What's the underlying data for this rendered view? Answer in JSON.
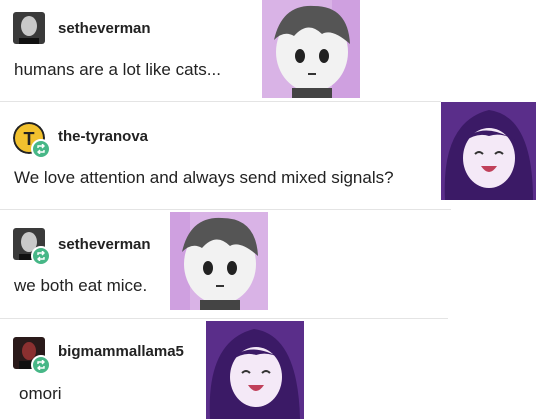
{
  "posts": [
    {
      "username": "setheverman",
      "text": "humans are a lot like cats...",
      "avatar_icon": "bald-man-avatar",
      "reblog": false,
      "image": "omori-boy-drawing"
    },
    {
      "username": "the-tyranova",
      "text": "We love attention and always send mixed signals?",
      "avatar_icon": "tyranova-logo-avatar",
      "reblog": true,
      "image": "omori-girl-laughing-drawing"
    },
    {
      "username": "setheverman",
      "text": "we both eat mice.",
      "avatar_icon": "bald-man-avatar",
      "reblog": true,
      "image": "omori-boy-drawing"
    },
    {
      "username": "bigmammallama5",
      "text": "omori",
      "avatar_icon": "dark-portrait-avatar",
      "reblog": true,
      "image": "omori-girl-laughing-drawing"
    }
  ],
  "colors": {
    "reblog_green": "#47b787",
    "divider": "#e4e4e4",
    "text": "#222222"
  }
}
